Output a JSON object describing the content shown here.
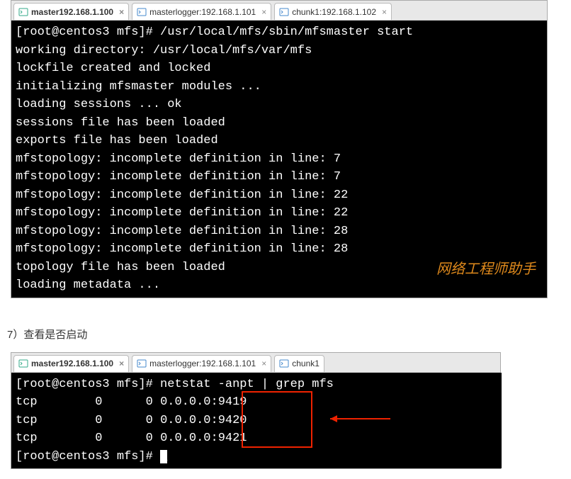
{
  "window1": {
    "tabs": [
      {
        "label": "master192.168.1.100",
        "active": true
      },
      {
        "label": "masterlogger:192.168.1.101",
        "active": false
      },
      {
        "label": "chunk1:192.168.1.102",
        "active": false
      }
    ],
    "prompt": "[root@centos3 mfs]# ",
    "command": "/usr/local/mfs/sbin/mfsmaster start",
    "lines": [
      "working directory: /usr/local/mfs/var/mfs",
      "lockfile created and locked",
      "initializing mfsmaster modules ...",
      "loading sessions ... ok",
      "sessions file has been loaded",
      "exports file has been loaded",
      "mfstopology: incomplete definition in line: 7",
      "mfstopology: incomplete definition in line: 7",
      "mfstopology: incomplete definition in line: 22",
      "mfstopology: incomplete definition in line: 22",
      "mfstopology: incomplete definition in line: 28",
      "mfstopology: incomplete definition in line: 28",
      "topology file has been loaded",
      "loading metadata ..."
    ],
    "watermark": "网络工程师助手"
  },
  "section_label": "7）查看是否启动",
  "window2": {
    "tabs": [
      {
        "label": "master192.168.1.100",
        "active": true
      },
      {
        "label": "masterlogger:192.168.1.101",
        "active": false
      },
      {
        "label": "chunk1",
        "active": false
      }
    ],
    "prompt": "[root@centos3 mfs]# ",
    "command": "netstat -anpt | grep mfs",
    "rows": [
      {
        "proto": "tcp",
        "recv": "0",
        "send": "0",
        "addr": "0.0.0.0:",
        "port": "9419"
      },
      {
        "proto": "tcp",
        "recv": "0",
        "send": "0",
        "addr": "0.0.0.0:",
        "port": "9420"
      },
      {
        "proto": "tcp",
        "recv": "0",
        "send": "0",
        "addr": "0.0.0.0:",
        "port": "9421"
      }
    ],
    "prompt2": "[root@centos3 mfs]# "
  }
}
